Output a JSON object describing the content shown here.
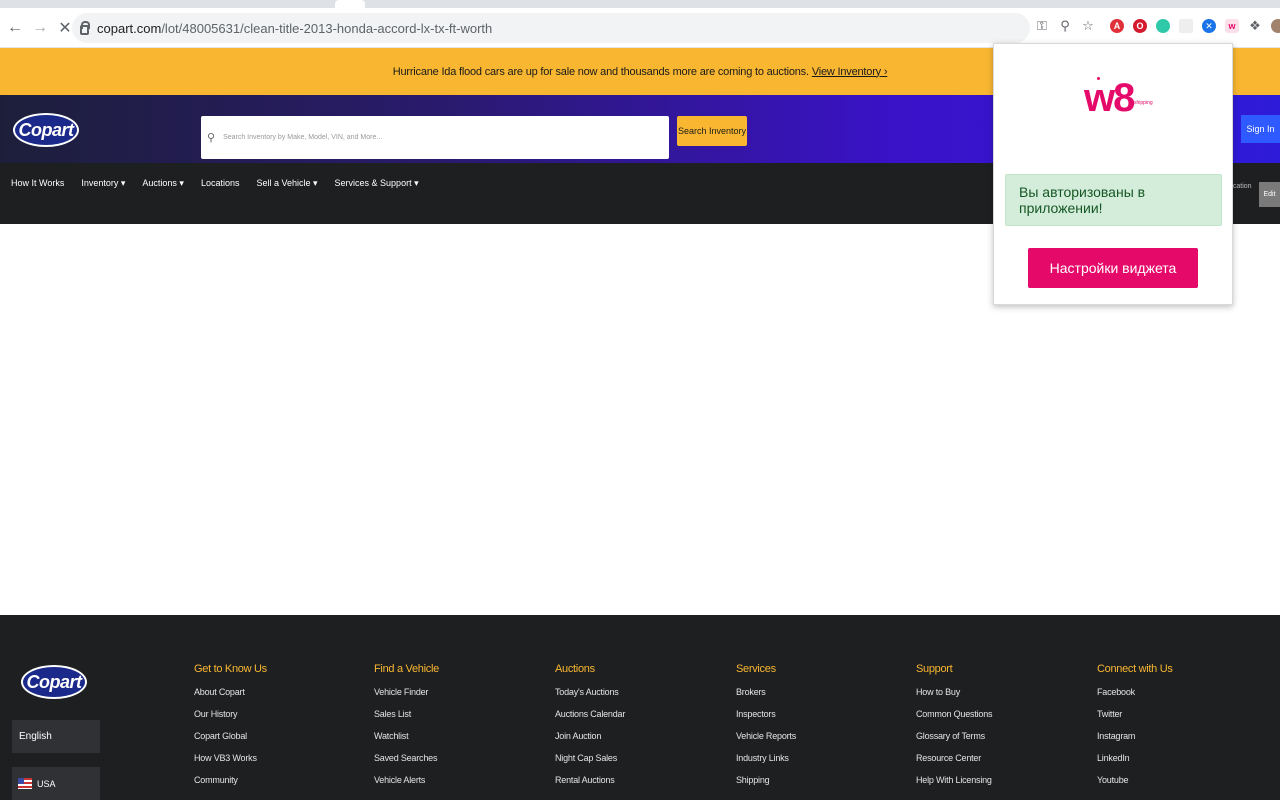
{
  "browser": {
    "url_host": "copart.com",
    "url_path": "/lot/48005631/clean-title-2013-honda-accord-lx-tx-ft-worth"
  },
  "banner": {
    "text": "Hurricane Ida flood cars are up for sale now and thousands more are coming to auctions.",
    "link": "View Inventory ›"
  },
  "header": {
    "logo": "Copart",
    "search_placeholder": "Search Inventory by Make, Model, VIN, and More...",
    "search_button": "Search Inventory",
    "sign_in": "Sign In"
  },
  "nav": {
    "items": [
      "How It Works",
      "Inventory ▾",
      "Auctions ▾",
      "Locations",
      "Sell a Vehicle ▾",
      "Services & Support ▾"
    ],
    "location_label": "ocation",
    "edit_label": "Edit"
  },
  "popup": {
    "logo": "w8",
    "logo_sub": "shipping",
    "auth_message": "Вы авторизованы в приложении!",
    "settings_button": "Настройки виджета"
  },
  "footer": {
    "logo": "Copart",
    "language": "English",
    "country": "USA",
    "columns": [
      {
        "title": "Get to Know Us",
        "items": [
          "About Copart",
          "Our History",
          "Copart Global",
          "How VB3 Works",
          "Community"
        ]
      },
      {
        "title": "Find a Vehicle",
        "items": [
          "Vehicle Finder",
          "Sales List",
          "Watchlist",
          "Saved Searches",
          "Vehicle Alerts"
        ]
      },
      {
        "title": "Auctions",
        "items": [
          "Today's Auctions",
          "Auctions Calendar",
          "Join Auction",
          "Night Cap Sales",
          "Rental Auctions"
        ]
      },
      {
        "title": "Services",
        "items": [
          "Brokers",
          "Inspectors",
          "Vehicle Reports",
          "Industry Links",
          "Shipping"
        ]
      },
      {
        "title": "Support",
        "items": [
          "How to Buy",
          "Common Questions",
          "Glossary of Terms",
          "Resource Center",
          "Help With Licensing"
        ]
      },
      {
        "title": "Connect with Us",
        "items": [
          "Facebook",
          "Twitter",
          "Instagram",
          "LinkedIn",
          "Youtube"
        ]
      }
    ]
  },
  "colors": {
    "banner": "#f9b731",
    "accent_pink": "#e5096a",
    "signin_blue": "#2f5aff"
  }
}
